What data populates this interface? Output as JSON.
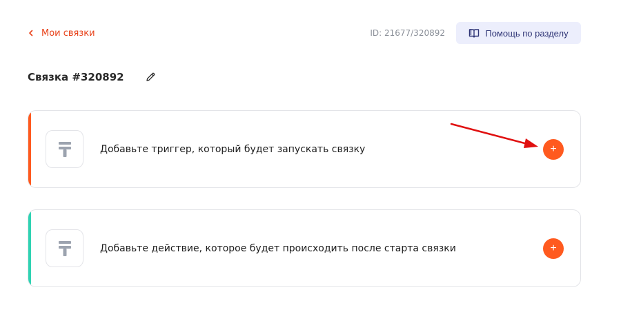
{
  "header": {
    "back_label": "Мои связки",
    "id_text": "ID: 21677/320892",
    "help_label": "Помощь по разделу"
  },
  "bundle": {
    "title": "Связка #320892"
  },
  "cards": [
    {
      "label": "Добавьте триггер, который будет запускать связку",
      "add_label": "+",
      "accent_color": "#ff5a1f",
      "icon": "placeholder-app-icon"
    },
    {
      "label": "Добавьте действие, которое будет происходить после старта связки",
      "add_label": "+",
      "accent_color": "#2fd3b3",
      "icon": "placeholder-app-icon"
    }
  ],
  "colors": {
    "brand_orange": "#ff5a1f",
    "link_red": "#e8421a",
    "annotation_red": "#e01010",
    "help_bg": "#eceefc",
    "help_text": "#2f3576"
  }
}
